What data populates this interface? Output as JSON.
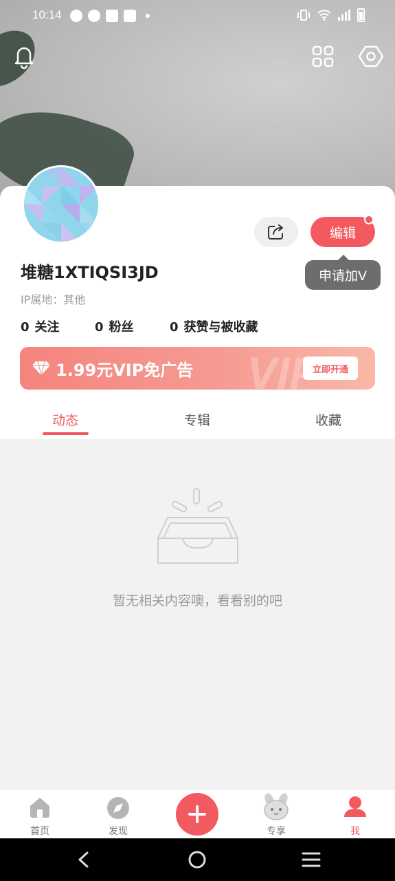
{
  "status_bar": {
    "time": "10:14"
  },
  "profile": {
    "username": "堆糖1XTIQSI3JD",
    "ip_location": "IP属地：其他",
    "edit_label": "编辑",
    "tooltip": "申请加V"
  },
  "stats": [
    {
      "num": "0",
      "label": "关注"
    },
    {
      "num": "0",
      "label": "粉丝"
    },
    {
      "num": "0",
      "label": "获赞与被收藏"
    }
  ],
  "vip_banner": {
    "text": "1.99元VIP免广告",
    "watermark": "VIP",
    "button": "立即开通"
  },
  "tabs": [
    {
      "label": "动态",
      "active": true
    },
    {
      "label": "专辑",
      "active": false
    },
    {
      "label": "收藏",
      "active": false
    }
  ],
  "empty_state": {
    "text": "暂无相关内容噢，看看别的吧"
  },
  "bottom_nav": [
    {
      "label": "首页",
      "icon": "home-icon",
      "active": false
    },
    {
      "label": "发现",
      "icon": "compass-icon",
      "active": false
    },
    {
      "label": "专享",
      "icon": "bunny-icon",
      "active": false
    },
    {
      "label": "我",
      "icon": "person-icon",
      "active": true
    }
  ],
  "colors": {
    "accent": "#f25a5f",
    "muted": "#999999",
    "background": "#f2f2f2"
  }
}
